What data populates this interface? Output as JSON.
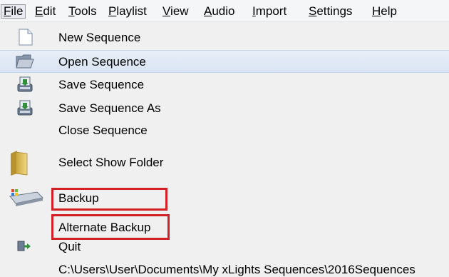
{
  "menubar": {
    "items": [
      {
        "pre": "",
        "acc": "F",
        "post": "ile"
      },
      {
        "pre": "",
        "acc": "E",
        "post": "dit"
      },
      {
        "pre": "",
        "acc": "T",
        "post": "ools"
      },
      {
        "pre": "",
        "acc": "P",
        "post": "laylist"
      },
      {
        "pre": "",
        "acc": "V",
        "post": "iew"
      },
      {
        "pre": "",
        "acc": "A",
        "post": "udio"
      },
      {
        "pre": "",
        "acc": "I",
        "post": "mport"
      },
      {
        "pre": "",
        "acc": "S",
        "post": "ettings"
      },
      {
        "pre": "",
        "acc": "H",
        "post": "elp"
      }
    ]
  },
  "file_menu": {
    "new_sequence": "New Sequence",
    "open_sequence": "Open Sequence",
    "save_sequence": "Save Sequence",
    "save_sequence_as": "Save Sequence As",
    "close_sequence": "Close Sequence",
    "select_show_folder": "Select Show Folder",
    "backup": "Backup",
    "alternate_backup": "Alternate Backup",
    "quit": "Quit",
    "recent_path": "C:\\Users\\User\\Documents\\My xLights Sequences\\2016Sequences"
  },
  "colors": {
    "highlight_box": "#d22027",
    "hover_row": "#dce6f4"
  }
}
